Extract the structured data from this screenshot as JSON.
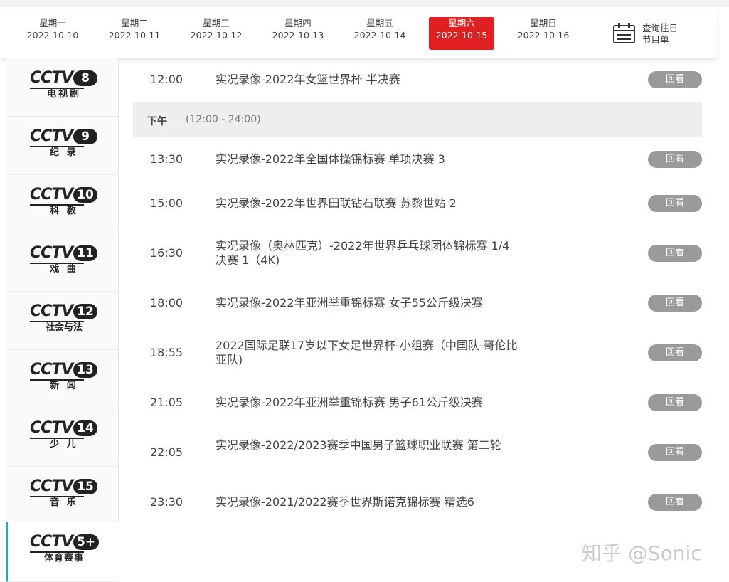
{
  "days": [
    {
      "weekday": "星期一",
      "date": "2022-10-10"
    },
    {
      "weekday": "星期二",
      "date": "2022-10-11"
    },
    {
      "weekday": "星期三",
      "date": "2022-10-12"
    },
    {
      "weekday": "星期四",
      "date": "2022-10-13"
    },
    {
      "weekday": "星期五",
      "date": "2022-10-14"
    },
    {
      "weekday": "星期六",
      "date": "2022-10-15"
    },
    {
      "weekday": "星期日",
      "date": "2022-10-16"
    }
  ],
  "active_day": "2022-10-15",
  "calendar": {
    "line1": "查询往日",
    "line2": "节目单",
    "icon": "calendar-icon"
  },
  "channels": [
    {
      "brand": "CCTV",
      "number": "8",
      "name": "电视剧"
    },
    {
      "brand": "CCTV",
      "number": "9",
      "name": "纪 录"
    },
    {
      "brand": "CCTV",
      "number": "10",
      "name": "科 教"
    },
    {
      "brand": "CCTV",
      "number": "11",
      "name": "戏 曲"
    },
    {
      "brand": "CCTV",
      "number": "12",
      "name": "社会与法"
    },
    {
      "brand": "CCTV",
      "number": "13",
      "name": "新 闻"
    },
    {
      "brand": "CCTV",
      "number": "14",
      "name": "少 儿"
    },
    {
      "brand": "CCTV",
      "number": "15",
      "name": "音 乐"
    },
    {
      "brand": "CCTV",
      "number": "5+",
      "name": "体育赛事"
    }
  ],
  "active_channel": "5+",
  "section": {
    "label": "下午",
    "range": "(12:00 - 24:00)"
  },
  "replay_label": "回看",
  "programs": [
    {
      "time": "12:00",
      "title": "实况录像-2022年女篮世界杯 半决赛"
    },
    {
      "time": "13:30",
      "title": "实况录像-2022年全国体操锦标赛 单项决赛 3"
    },
    {
      "time": "15:00",
      "title": "实况录像-2022年世界田联钻石联赛 苏黎世站 2"
    },
    {
      "time": "16:30",
      "title": "实况录像（奥林匹克）-2022年世界乒乓球团体锦标赛 1/4决赛 1（4K)"
    },
    {
      "time": "18:00",
      "title": "实况录像-2022年亚洲举重锦标赛 女子55公斤级决赛"
    },
    {
      "time": "18:55",
      "title": "2022国际足联17岁以下女足世界杯-小组赛（中国队-哥伦比亚队)"
    },
    {
      "time": "21:05",
      "title": "实况录像-2022年亚洲举重锦标赛 男子61公斤级决赛"
    },
    {
      "time": "22:05",
      "title": "实况录像-2022/2023赛季中国男子篮球职业联赛 第二轮"
    },
    {
      "time": "23:30",
      "title": "实况录像-2021/2022赛季世界斯诺克锦标赛 精选6"
    }
  ],
  "colors": {
    "accent": "#e02020",
    "replay_button": "#9a9a9a",
    "active_channel_bar": "#28a8c8"
  },
  "watermark": "知乎 @Sonic"
}
